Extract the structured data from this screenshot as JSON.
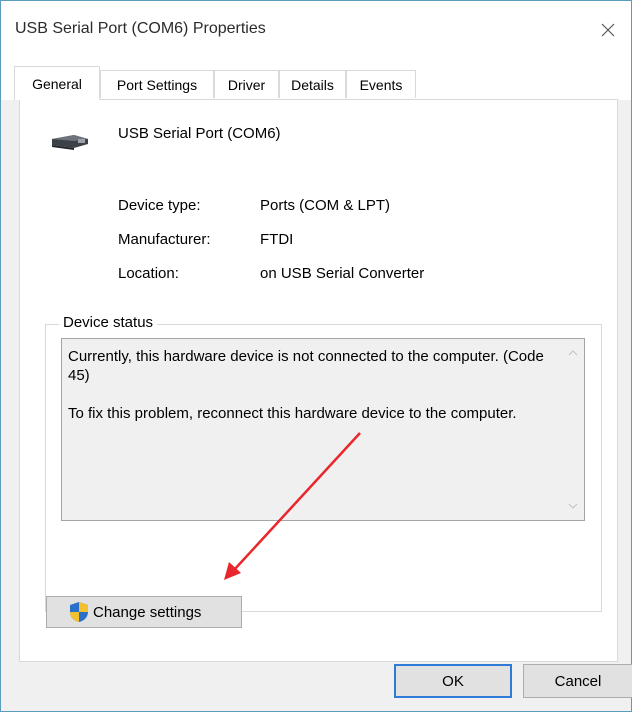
{
  "window": {
    "title": "USB Serial Port (COM6) Properties",
    "close_glyph": "✕"
  },
  "tabs": [
    {
      "label": "General",
      "active": true
    },
    {
      "label": "Port Settings",
      "active": false
    },
    {
      "label": "Driver",
      "active": false
    },
    {
      "label": "Details",
      "active": false
    },
    {
      "label": "Events",
      "active": false
    }
  ],
  "device": {
    "name": "USB Serial Port (COM6)",
    "icon": "usb-connector-icon",
    "properties": [
      {
        "label": "Device type:",
        "value": "Ports (COM & LPT)"
      },
      {
        "label": "Manufacturer:",
        "value": "FTDI"
      },
      {
        "label": "Location:",
        "value": "on USB Serial Converter"
      }
    ]
  },
  "status": {
    "legend": "Device status",
    "line1": "Currently, this hardware device is not connected to the computer. (Code 45)",
    "line2": "To fix this problem, reconnect this hardware device to the computer."
  },
  "buttons": {
    "change_settings": "Change settings",
    "change_settings_icon": "uac-shield-icon",
    "ok": "OK",
    "cancel": "Cancel"
  },
  "colors": {
    "window_border": "#5b9bbd",
    "default_button_border": "#2f7cd6",
    "annotation_arrow": "#e8262b"
  }
}
